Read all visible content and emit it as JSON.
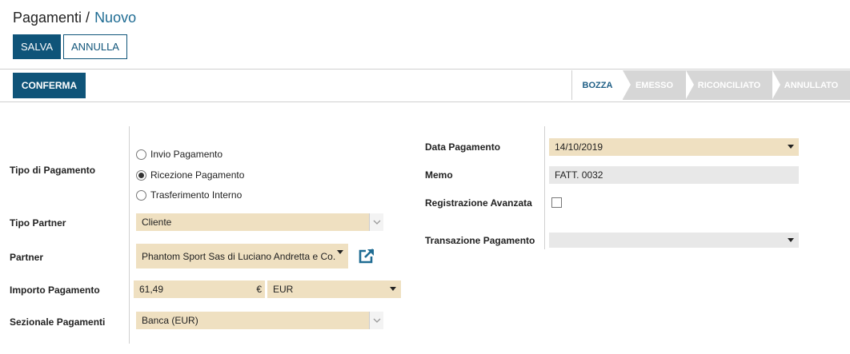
{
  "breadcrumb": {
    "parent": "Pagamenti /",
    "current": "Nuovo"
  },
  "actions": {
    "save": "SALVA",
    "cancel": "ANNULLA",
    "confirm": "CONFERMA"
  },
  "status": {
    "stages": [
      "BOZZA",
      "EMESSO",
      "RICONCILIATO",
      "ANNULLATO"
    ],
    "active": "BOZZA"
  },
  "form": {
    "payment_type": {
      "label": "Tipo di Pagamento",
      "options": [
        "Invio Pagamento",
        "Ricezione Pagamento",
        "Trasferimento Interno"
      ],
      "selected": "Ricezione Pagamento"
    },
    "partner_type": {
      "label": "Tipo Partner",
      "value": "Cliente"
    },
    "partner": {
      "label": "Partner",
      "value": "Phantom Sport Sas di Luciano Andretta e Co."
    },
    "amount": {
      "label": "Importo Pagamento",
      "value": "61,49",
      "symbol": "€",
      "currency": "EUR"
    },
    "journal": {
      "label": "Sezionale Pagamenti",
      "value": "Banca (EUR)"
    },
    "payment_date": {
      "label": "Data Pagamento",
      "value": "14/10/2019"
    },
    "memo": {
      "label": "Memo",
      "value": "FATT. 0032"
    },
    "advanced": {
      "label": "Registrazione Avanzata",
      "checked": false
    },
    "transaction": {
      "label": "Transazione Pagamento",
      "value": ""
    }
  },
  "colors": {
    "primary": "#0f5479",
    "required_bg": "#efe0c1",
    "readonly_bg": "#e8e8e8"
  }
}
